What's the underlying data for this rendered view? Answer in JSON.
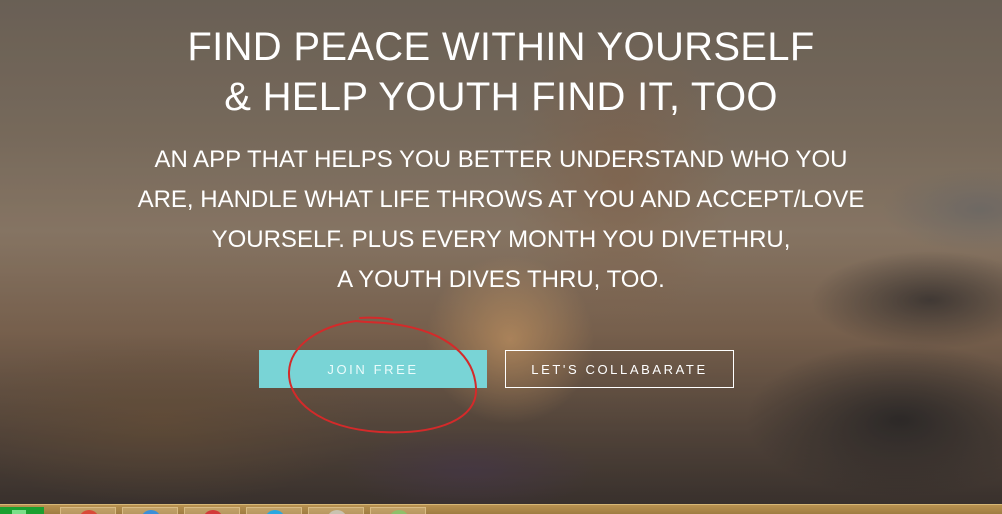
{
  "hero": {
    "headline_line1": "FIND PEACE WITHIN YOURSELF",
    "headline_line2": "& HELP YOUTH FIND IT, TOO",
    "sub_line1": "AN APP THAT HELPS YOU BETTER UNDERSTAND WHO YOU",
    "sub_line2": "ARE, HANDLE WHAT LIFE THROWS AT YOU AND ACCEPT/LOVE",
    "sub_line3": "YOURSELF. PLUS EVERY MONTH YOU DIVETHRU,",
    "sub_line4": "A YOUTH DIVES THRU, TOO."
  },
  "buttons": {
    "join_label": "JOIN FREE",
    "collab_label": "LET'S COLLABARATE"
  },
  "colors": {
    "join_button_bg": "#79d4d6",
    "annotation_circle": "#d42a2a",
    "taskbar": "#b89250"
  },
  "taskbar": {
    "items": [
      {
        "icon": "chrome-icon"
      },
      {
        "icon": "ie-icon"
      },
      {
        "icon": "opera-icon"
      },
      {
        "icon": "skype-icon"
      },
      {
        "icon": "folder-icon"
      },
      {
        "icon": "notepad-icon"
      }
    ]
  }
}
